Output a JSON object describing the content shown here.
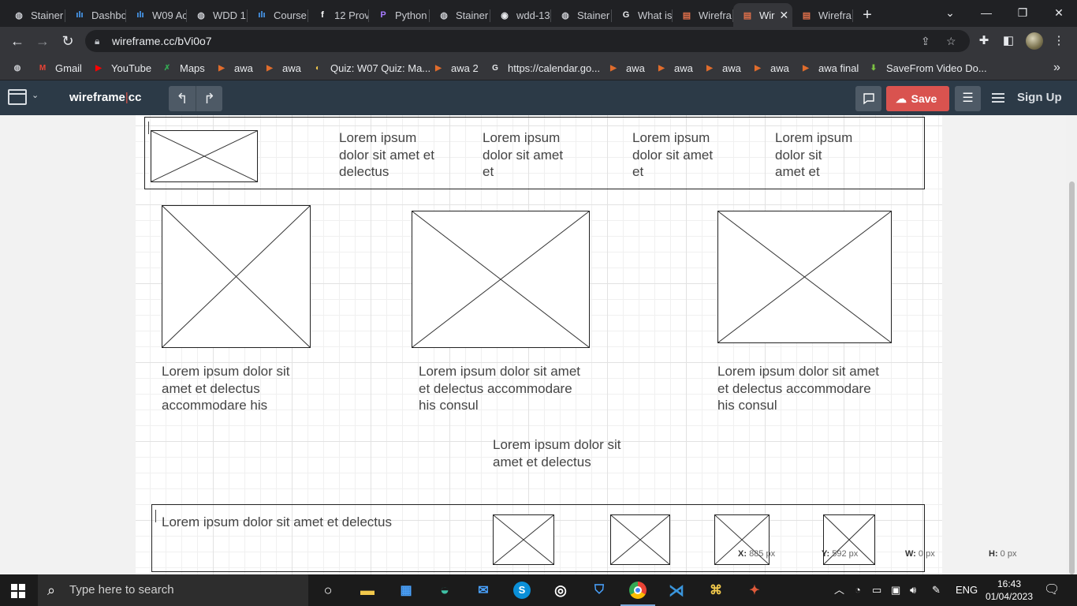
{
  "browser": {
    "tabs": [
      {
        "label": "Stainer",
        "icon": "globe-icon"
      },
      {
        "label": "Dashbo",
        "icon": "chart-icon"
      },
      {
        "label": "W09 Ac",
        "icon": "chart-icon"
      },
      {
        "label": "WDD 1",
        "icon": "globe-icon"
      },
      {
        "label": "Course",
        "icon": "chart-icon"
      },
      {
        "label": "12 Prov",
        "icon": "f-icon"
      },
      {
        "label": "Python",
        "icon": "python-icon"
      },
      {
        "label": "Stainer",
        "icon": "globe-icon"
      },
      {
        "label": "wdd-13",
        "icon": "github-icon"
      },
      {
        "label": "Stainer",
        "icon": "globe-icon"
      },
      {
        "label": "What is",
        "icon": "google-icon"
      },
      {
        "label": "Wirefra",
        "icon": "wireframe-icon"
      },
      {
        "label": "Wir",
        "icon": "wireframe-icon",
        "active": true
      },
      {
        "label": "Wirefra",
        "icon": "wireframe-icon"
      }
    ],
    "close_glyph": "✕",
    "new_tab_glyph": "+",
    "address": "wireframe.cc/bVi0o7",
    "bookmarks": [
      {
        "label": "",
        "icon": "globe-icon"
      },
      {
        "label": "Gmail",
        "icon": "gmail-icon"
      },
      {
        "label": "YouTube",
        "icon": "youtube-icon"
      },
      {
        "label": "Maps",
        "icon": "maps-icon"
      },
      {
        "label": "awa",
        "icon": "bookmark-icon"
      },
      {
        "label": "awa",
        "icon": "bookmark-icon"
      },
      {
        "label": "Quiz: W07 Quiz: Ma...",
        "icon": "quiz-icon"
      },
      {
        "label": "awa 2",
        "icon": "bookmark-icon"
      },
      {
        "label": "https://calendar.go...",
        "icon": "google-icon"
      },
      {
        "label": "awa",
        "icon": "bookmark-icon"
      },
      {
        "label": "awa",
        "icon": "bookmark-icon"
      },
      {
        "label": "awa",
        "icon": "bookmark-icon"
      },
      {
        "label": "awa",
        "icon": "bookmark-icon"
      },
      {
        "label": "awa final",
        "icon": "bookmark-icon"
      },
      {
        "label": "SaveFrom Video Do...",
        "icon": "download-icon"
      }
    ],
    "bookmarks_overflow": "»"
  },
  "app": {
    "brand_left": "wireframe",
    "brand_sep": "|",
    "brand_right": "cc",
    "undo_glyph": "↰",
    "redo_glyph": "↱",
    "save_label": "Save",
    "signup_label": "Sign Up"
  },
  "wireframe": {
    "header_texts": [
      "Lorem ipsum dolor sit amet et delectus",
      "Lorem ipsum dolor sit amet et",
      "Lorem ipsum dolor sit amet et",
      "Lorem ipsum dolor sit amet et"
    ],
    "captions": [
      "Lorem ipsum dolor sit amet et delectus accommodare his",
      "Lorem ipsum dolor sit amet et delectus accommodare his consul",
      "Lorem ipsum dolor sit amet et delectus accommodare his consul"
    ],
    "center_text": "Lorem ipsum dolor sit amet et delectus",
    "footer_text": "Lorem ipsum dolor sit amet et delectus"
  },
  "readout": {
    "x_label": "X:",
    "x_value": "885 px",
    "y_label": "Y:",
    "y_value": "592 px",
    "w_label": "W:",
    "w_value": "0 px",
    "h_label": "H:",
    "h_value": "0 px"
  },
  "taskbar": {
    "search_placeholder": "Type here to search",
    "language": "ENG",
    "time": "16:43",
    "date": "01/04/2023"
  }
}
